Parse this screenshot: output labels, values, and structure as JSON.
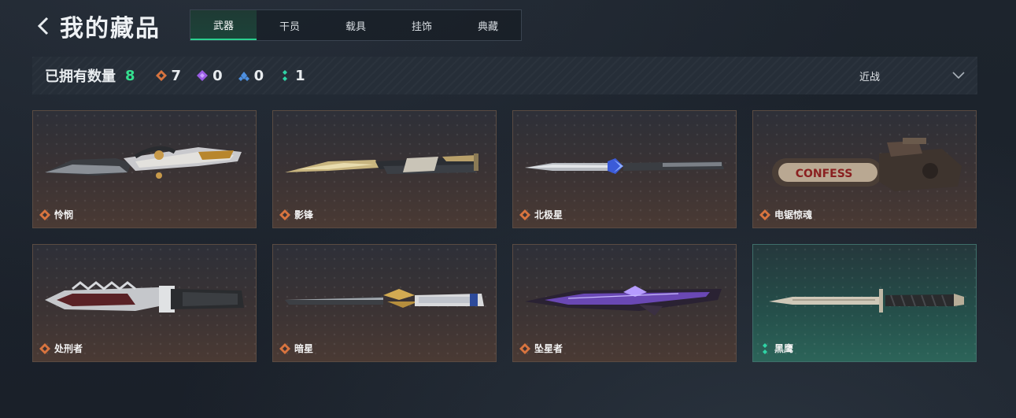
{
  "header": {
    "title": "我的藏品"
  },
  "tabs": [
    {
      "label": "武器",
      "active": true
    },
    {
      "label": "干员",
      "active": false
    },
    {
      "label": "载具",
      "active": false
    },
    {
      "label": "挂饰",
      "active": false
    },
    {
      "label": "典藏",
      "active": false
    }
  ],
  "summary": {
    "owned_label": "已拥有数量",
    "owned_count": "8",
    "stats": [
      {
        "icon": "orange-diamond-icon",
        "color": "#d8743f",
        "count": "7"
      },
      {
        "icon": "purple-diamond-icon",
        "color": "#9b5de5",
        "count": "0"
      },
      {
        "icon": "blue-diamond-icon",
        "color": "#4d8fe0",
        "count": "0"
      },
      {
        "icon": "teal-dots-icon",
        "color": "#2fd3a5",
        "count": "1"
      }
    ]
  },
  "filter": {
    "selected": "近战"
  },
  "items": [
    {
      "name": "怜悯",
      "rarity": "orange"
    },
    {
      "name": "影锋",
      "rarity": "orange"
    },
    {
      "name": "北极星",
      "rarity": "orange"
    },
    {
      "name": "电锯惊魂",
      "rarity": "orange",
      "blade_text": "CONFESS"
    },
    {
      "name": "处刑者",
      "rarity": "orange"
    },
    {
      "name": "暗星",
      "rarity": "orange"
    },
    {
      "name": "坠星者",
      "rarity": "orange"
    },
    {
      "name": "黑鹰",
      "rarity": "teal"
    }
  ],
  "colors": {
    "accent_green": "#34e08f",
    "orange_rarity": "#d8743f",
    "teal_rarity": "#2fd3a5"
  }
}
